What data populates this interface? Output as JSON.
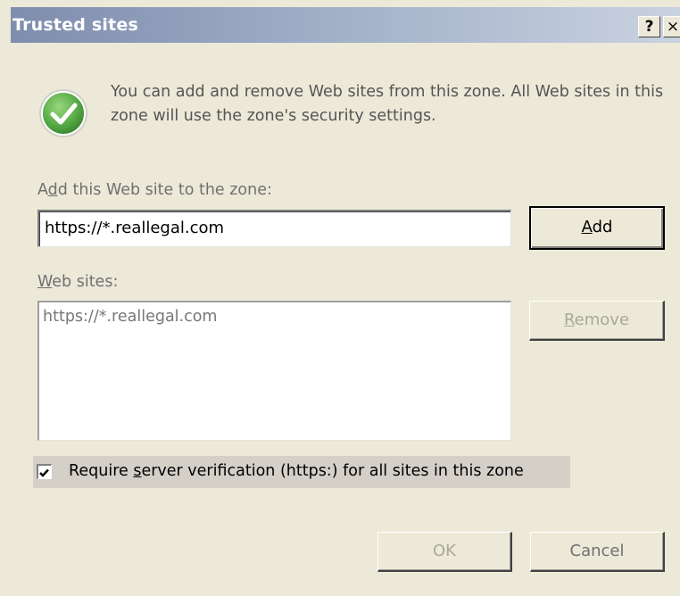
{
  "dialog": {
    "title": "Trusted sites",
    "help_label": "?",
    "close_label": "×"
  },
  "info": {
    "icon": "green-checkmark-icon",
    "text": "You can add and remove Web sites from this zone. All Web sites in this zone will use the zone's security settings."
  },
  "add_site": {
    "label_before": "A",
    "label_accel": "d",
    "label_after": "d this Web site to the zone:",
    "value": "https://*.reallegal.com",
    "button_accel": "A",
    "button_rest": "dd"
  },
  "websites": {
    "label_accel": "W",
    "label_rest": "eb sites:",
    "items": [
      "https://*.reallegal.com"
    ],
    "remove_accel": "R",
    "remove_rest": "emove"
  },
  "verification": {
    "checked": true,
    "label_before": "Require ",
    "label_accel": "s",
    "label_after": "erver verification (https:) for all sites in this zone"
  },
  "footer": {
    "ok_label": "OK",
    "cancel_label": "Cancel"
  },
  "colors": {
    "titlebar_start": "#7F8DAE",
    "titlebar_end": "#C9D2E0",
    "dialog_bg": "#ECE9D8",
    "check_icon_green": "#5DB04A"
  }
}
